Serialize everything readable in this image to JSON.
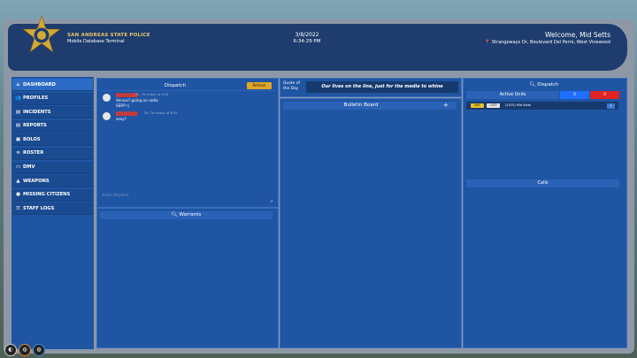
{
  "header": {
    "agency": "SAN ANDREAS STATE POLICE",
    "subtitle": "Mobile Database Terminal",
    "date": "3/8/2022",
    "time": "6:34:29 PM",
    "welcome": "Welcome, Mid Setts",
    "location": "Strangeways Dr, Boulevard Del Perro, West Vinewood"
  },
  "sidebar": {
    "items": [
      {
        "label": "DASHBOARD",
        "icon": "home-icon"
      },
      {
        "label": "PROFILES",
        "icon": "users-icon"
      },
      {
        "label": "INCIDENTS",
        "icon": "file-icon"
      },
      {
        "label": "REPORTS",
        "icon": "file-icon"
      },
      {
        "label": "BOLOS",
        "icon": "car-icon"
      },
      {
        "label": "ROSTER",
        "icon": "link-icon"
      },
      {
        "label": "DMV",
        "icon": "card-icon"
      },
      {
        "label": "WEAPONS",
        "icon": "warning-icon"
      },
      {
        "label": "MISSING CITIZENS",
        "icon": "person-icon"
      },
      {
        "label": "STAFF LOGS",
        "icon": "list-icon"
      }
    ]
  },
  "dispatch": {
    "title": "Dispatch",
    "refresh_label": "Refresh",
    "messages": [
      {
        "name": "████████",
        "time": "5h, Thursday at 6:34",
        "text": "Versus? going on radio\nSERP rj"
      },
      {
        "name": "████████",
        "time": "5h, Thursday at 6:35",
        "text": "sexy?"
      }
    ],
    "input_placeholder": "Enter Dispatch"
  },
  "warrants": {
    "title": "Warrants"
  },
  "quote": {
    "label": "Quote of the Day",
    "text": "Our lives on the line, just for the media to whine"
  },
  "bulletin": {
    "title": "Bulletin Board",
    "add": "+"
  },
  "right": {
    "title": "Dispatch",
    "active_units_label": "Active Units",
    "blue_count": "0",
    "red_count": "0",
    "unit": {
      "tag1": "MAY",
      "tag2": "LSPD",
      "name": "(2015) Mid Setts",
      "btn": "5"
    },
    "calls_label": "Calls"
  },
  "colors": {
    "header": "#1e3c6e",
    "panel": "#1f55a3",
    "accent_gold": "#e0a624",
    "red": "#e02424",
    "blue": "#1f6fff"
  }
}
